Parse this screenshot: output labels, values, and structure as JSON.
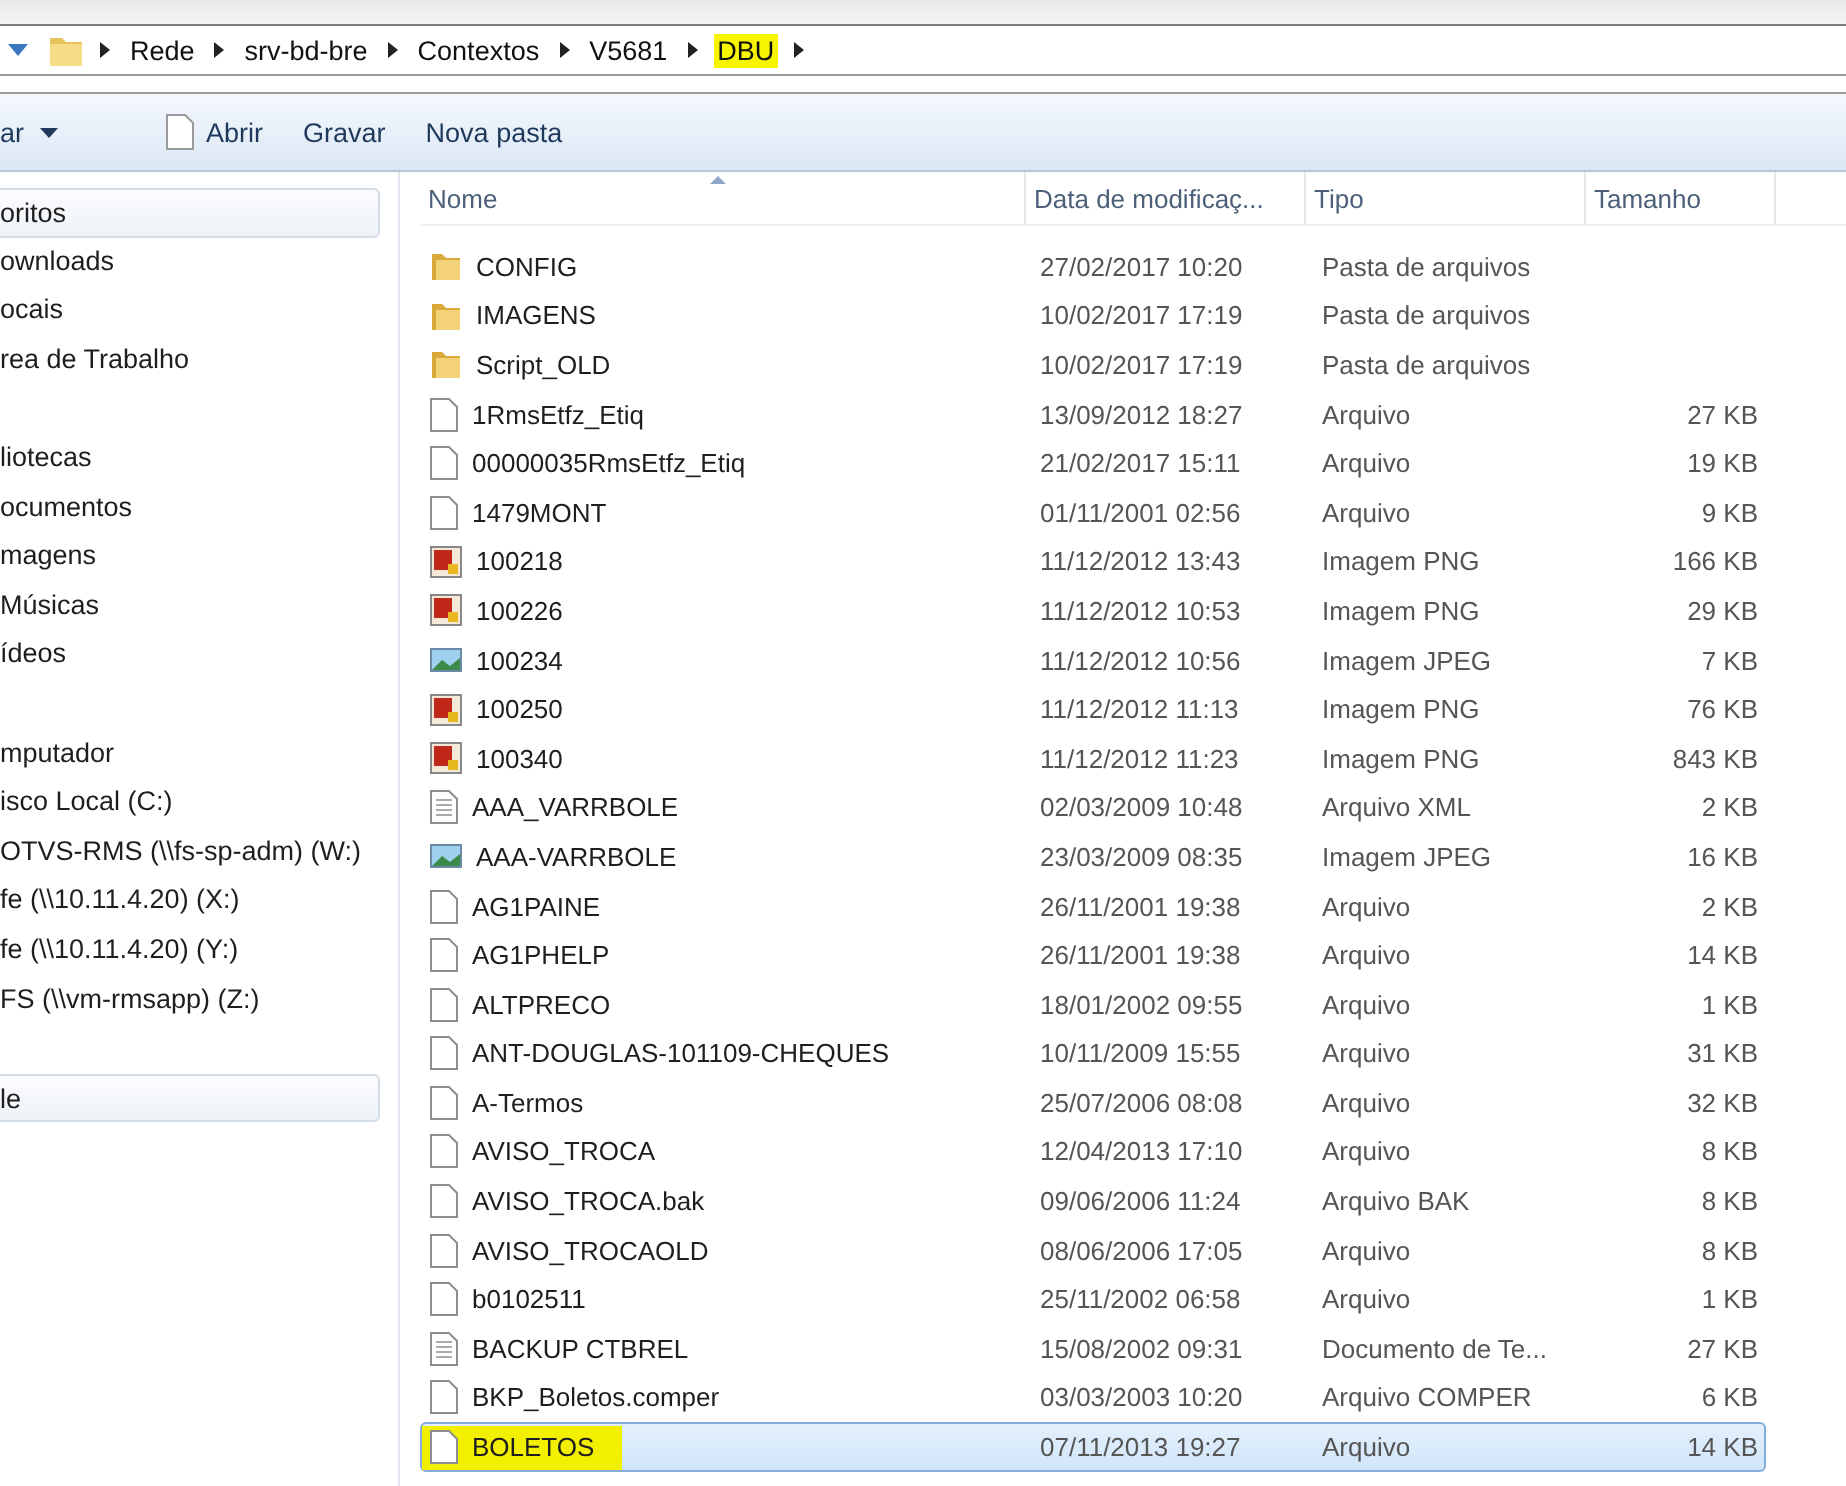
{
  "address_bar": {
    "crumbs": [
      {
        "label": "Rede",
        "highlighted": false
      },
      {
        "label": "srv-bd-bre",
        "highlighted": false
      },
      {
        "label": "Contextos",
        "highlighted": false
      },
      {
        "label": "V5681",
        "highlighted": false
      },
      {
        "label": "DBU",
        "highlighted": true
      }
    ]
  },
  "toolbar": {
    "organize": "ar",
    "buttons": [
      {
        "label": "Abrir",
        "kind": "open"
      },
      {
        "label": "Gravar",
        "kind": "plain"
      },
      {
        "label": "Nova pasta",
        "kind": "plain"
      }
    ]
  },
  "sidebar": {
    "groups": [
      [
        {
          "label": "oritos",
          "kind": "boxed"
        },
        {
          "label": "ownloads",
          "kind": "item"
        },
        {
          "label": "ocais",
          "kind": "item"
        },
        {
          "label": "rea de Trabalho",
          "kind": "item"
        }
      ],
      [
        {
          "label": "liotecas",
          "kind": "item"
        },
        {
          "label": "ocumentos",
          "kind": "item"
        },
        {
          "label": "magens",
          "kind": "item"
        },
        {
          "label": "Músicas",
          "kind": "item"
        },
        {
          "label": "ídeos",
          "kind": "item"
        }
      ],
      [
        {
          "label": "mputador",
          "kind": "item"
        },
        {
          "label": "isco Local (C:)",
          "kind": "item"
        },
        {
          "label": "OTVS-RMS (\\\\fs-sp-adm) (W:)",
          "kind": "item"
        },
        {
          "label": "fe (\\\\10.11.4.20) (X:)",
          "kind": "item"
        },
        {
          "label": "fe (\\\\10.11.4.20) (Y:)",
          "kind": "item"
        },
        {
          "label": "FS (\\\\vm-rmsapp) (Z:)",
          "kind": "item"
        }
      ],
      [
        {
          "label": "le",
          "kind": "boxed"
        }
      ]
    ]
  },
  "table": {
    "columns": [
      "Nome",
      "Data de modificaç...",
      "Tipo",
      "Tamanho"
    ],
    "rows": [
      {
        "kind": "folder",
        "name": "CONFIG",
        "date": "27/02/2017 10:20",
        "type": "Pasta de arquivos",
        "selected": false,
        "highlighted": false
      },
      {
        "kind": "folder",
        "name": "IMAGENS",
        "date": "10/02/2017 17:19",
        "type": "Pasta de arquivos",
        "selected": false,
        "highlighted": false
      },
      {
        "kind": "folder",
        "name": "Script_OLD",
        "date": "10/02/2017 17:19",
        "type": "Pasta de arquivos",
        "selected": false,
        "highlighted": false
      },
      {
        "kind": "file",
        "name": "1RmsEtfz_Etiq",
        "date": "13/09/2012 18:27",
        "type": "Arquivo",
        "size": "27 KB",
        "selected": false,
        "highlighted": false
      },
      {
        "kind": "file",
        "name": "00000035RmsEtfz_Etiq",
        "date": "21/02/2017 15:11",
        "type": "Arquivo",
        "size": "19 KB",
        "selected": false,
        "highlighted": false
      },
      {
        "kind": "file",
        "name": "1479MONT",
        "date": "01/11/2001 02:56",
        "type": "Arquivo",
        "size": "9 KB",
        "selected": false,
        "highlighted": false
      },
      {
        "kind": "png",
        "name": "100218",
        "date": "11/12/2012 13:43",
        "type": "Imagem PNG",
        "size": "166 KB",
        "selected": false,
        "highlighted": false
      },
      {
        "kind": "png",
        "name": "100226",
        "date": "11/12/2012 10:53",
        "type": "Imagem PNG",
        "size": "29 KB",
        "selected": false,
        "highlighted": false
      },
      {
        "kind": "jpeg",
        "name": "100234",
        "date": "11/12/2012 10:56",
        "type": "Imagem JPEG",
        "size": "7 KB",
        "selected": false,
        "highlighted": false
      },
      {
        "kind": "png",
        "name": "100250",
        "date": "11/12/2012 11:13",
        "type": "Imagem PNG",
        "size": "76 KB",
        "selected": false,
        "highlighted": false
      },
      {
        "kind": "png",
        "name": "100340",
        "date": "11/12/2012 11:23",
        "type": "Imagem PNG",
        "size": "843 KB",
        "selected": false,
        "highlighted": false
      },
      {
        "kind": "doc",
        "name": "AAA_VARRBOLE",
        "date": "02/03/2009 10:48",
        "type": "Arquivo XML",
        "size": "2 KB",
        "selected": false,
        "highlighted": false
      },
      {
        "kind": "jpeg",
        "name": "AAA-VARRBOLE",
        "date": "23/03/2009 08:35",
        "type": "Imagem JPEG",
        "size": "16 KB",
        "selected": false,
        "highlighted": false
      },
      {
        "kind": "file",
        "name": "AG1PAINE",
        "date": "26/11/2001 19:38",
        "type": "Arquivo",
        "size": "2 KB",
        "selected": false,
        "highlighted": false
      },
      {
        "kind": "file",
        "name": "AG1PHELP",
        "date": "26/11/2001 19:38",
        "type": "Arquivo",
        "size": "14 KB",
        "selected": false,
        "highlighted": false
      },
      {
        "kind": "file",
        "name": "ALTPRECO",
        "date": "18/01/2002 09:55",
        "type": "Arquivo",
        "size": "1 KB",
        "selected": false,
        "highlighted": false
      },
      {
        "kind": "file",
        "name": "ANT-DOUGLAS-101109-CHEQUES",
        "date": "10/11/2009 15:55",
        "type": "Arquivo",
        "size": "31 KB",
        "selected": false,
        "highlighted": false
      },
      {
        "kind": "file",
        "name": "A-Termos",
        "date": "25/07/2006 08:08",
        "type": "Arquivo",
        "size": "32 KB",
        "selected": false,
        "highlighted": false
      },
      {
        "kind": "file",
        "name": "AVISO_TROCA",
        "date": "12/04/2013 17:10",
        "type": "Arquivo",
        "size": "8 KB",
        "selected": false,
        "highlighted": false
      },
      {
        "kind": "file",
        "name": "AVISO_TROCA.bak",
        "date": "09/06/2006 11:24",
        "type": "Arquivo BAK",
        "size": "8 KB",
        "selected": false,
        "highlighted": false
      },
      {
        "kind": "file",
        "name": "AVISO_TROCAOLD",
        "date": "08/06/2006 17:05",
        "type": "Arquivo",
        "size": "8 KB",
        "selected": false,
        "highlighted": false
      },
      {
        "kind": "file",
        "name": "b0102511",
        "date": "25/11/2002 06:58",
        "type": "Arquivo",
        "size": "1 KB",
        "selected": false,
        "highlighted": false
      },
      {
        "kind": "doc",
        "name": "BACKUP CTBREL",
        "date": "15/08/2002 09:31",
        "type": "Documento de Te...",
        "size": "27 KB",
        "selected": false,
        "highlighted": false
      },
      {
        "kind": "file",
        "name": "BKP_Boletos.comper",
        "date": "03/03/2003 10:20",
        "type": "Arquivo COMPER",
        "size": "6 KB",
        "selected": false,
        "highlighted": false
      },
      {
        "kind": "file",
        "name": "BOLETOS",
        "date": "07/11/2013 19:27",
        "type": "Arquivo",
        "size": "14 KB",
        "selected": true,
        "highlighted": true
      }
    ]
  }
}
